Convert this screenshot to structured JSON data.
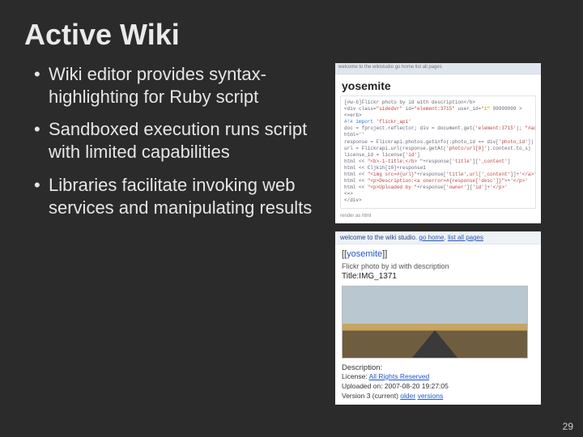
{
  "title": "Active Wiki",
  "bullets": [
    "Wiki editor provides syntax-highlighting for Ruby script",
    "Sandboxed execution runs script with limited capabilities",
    "Libraries facilitate invoking web services and manipulating results"
  ],
  "page_number": "29",
  "editor": {
    "tabbar": "welcome to the wikistudio  go home  list all pages",
    "result_word": "yosemite",
    "footer": "render as html"
  },
  "code": {
    "l1a": "[#w-b]Flickr photo by id with description</b>",
    "l2": "<div class=",
    "l2s": "\"sidedvr\"",
    "l2b": " id=",
    "l2s2": "\"element:3715\"",
    "l2c": " user_id=",
    "l2s3": "\"1\"",
    "l2d": " 99999999 >",
    "l3": "<=erb>",
    "l4": "#!# import ",
    "l4s": "'flickr_api'",
    "l5": "doc = fproject.reflector; div = document.get(",
    "l5s": "'element:3715'",
    "l5b": "); ",
    "l5s2": "\"#access parent tag\"",
    "l6": "html=",
    "l6s": "''",
    "l7": "response = Flickrapi.photos.getinfo(:photo_id == div[",
    "l7s": "'photo_id'",
    "l7b": "])",
    "l8": "url = Flickrapi.url(response.getAt(",
    "l8s": "'photo/url[0]'",
    "l8b": ").context.to_s)",
    "l9": "license_id = license[",
    "l9s": "'id'",
    "l9b": "]",
    "l10": "html << ",
    "l10s": "\"<b>-1-title:</b> \"",
    "l10b": "+response[",
    "l10s2": "'title'",
    "l10c": "][",
    "l10s3": "'_content'",
    "l10d": "]",
    "l11": "html << Cljkih[10]+response1",
    "l12": "html << ",
    "l12s": "\"<img src=#{url}\"",
    "l12b": "+response[",
    "l12s2": "'title',url['_content']",
    "l12c": "]+",
    "l12s3": "'</a>'",
    "l13": "html << ",
    "l13s": "\"<p>Description:<a onerror=#{response['desc']}\"",
    "l13b": ">+",
    "l13s2": "'</p>'",
    "l14": "html << ",
    "l14s": "\"<p>Uploaded by \"",
    "l14b": "+response[",
    "l14s2": "'owner'",
    "l14c": "][",
    "l14s3": "'id'",
    "l14d": "]+",
    "l14s4": "'</p>'",
    "l15": "<=>",
    "l16": "</div>"
  },
  "rendered": {
    "crumb_prefix": "welcome to the wiki studio. ",
    "crumb_link1": "go home",
    "crumb_mid": ". ",
    "crumb_link2": "list all pages",
    "tag_open": "[[",
    "tag_word": "yosemite",
    "tag_close": "]]",
    "sub": "Flickr photo by id with description",
    "tt": "Title:IMG_1371",
    "desc_label": "Description:",
    "license_label": "License: ",
    "license_link": "All Rights Reserved",
    "uploaded": "Uploaded on: 2007-08-20  19:27:05",
    "version_a": "Version 3 (current)  ",
    "version_link1": "older",
    "version_mid": "  ",
    "version_link2": "versions"
  }
}
